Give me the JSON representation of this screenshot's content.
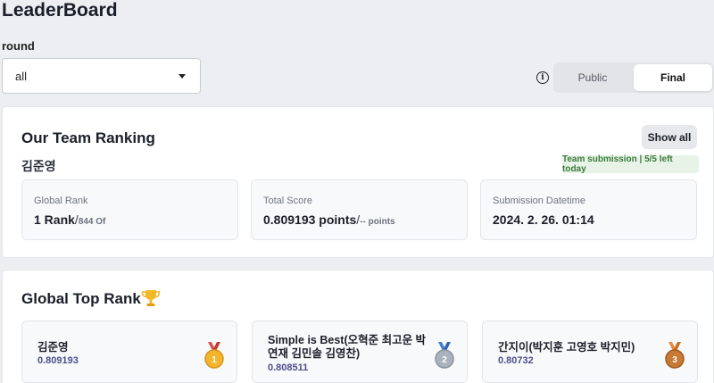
{
  "page": {
    "title": "LeaderBoard"
  },
  "filter": {
    "label": "round",
    "selected": "all"
  },
  "toggle": {
    "options": [
      "Public",
      "Final"
    ],
    "active": "Final"
  },
  "team_ranking": {
    "title": "Our Team Ranking",
    "show_all": "Show all",
    "team_name": "김준영",
    "submission_badge": "Team submission | 5/5 left today",
    "stats": [
      {
        "label": "Global Rank",
        "value": "1 Rank",
        "suffix": "844 Of"
      },
      {
        "label": "Total Score",
        "value": "0.809193 points",
        "suffix": "-- points"
      },
      {
        "label": "Submission Datetime",
        "value": "2024. 2. 26. 01:14"
      }
    ]
  },
  "global_top": {
    "title": "Global Top Rank",
    "icon": "trophy-icon",
    "entries": [
      {
        "rank": "1",
        "name": "김준영",
        "score": "0.809193",
        "medal_color": "#e0a82e"
      },
      {
        "rank": "2",
        "name": "Simple is Best(오혁준 최고운 박연재 김민솔 김영찬)",
        "score": "0.808511",
        "medal_color": "#9aa3ad"
      },
      {
        "rank": "3",
        "name": "간지이(박지훈 고영호 박지민)",
        "score": "0.80732",
        "medal_color": "#b86a2b"
      }
    ]
  },
  "colors": {
    "accent_score": "#4b4e8c",
    "badge_bg": "#e6f3e6",
    "badge_text": "#3c7a3c"
  }
}
